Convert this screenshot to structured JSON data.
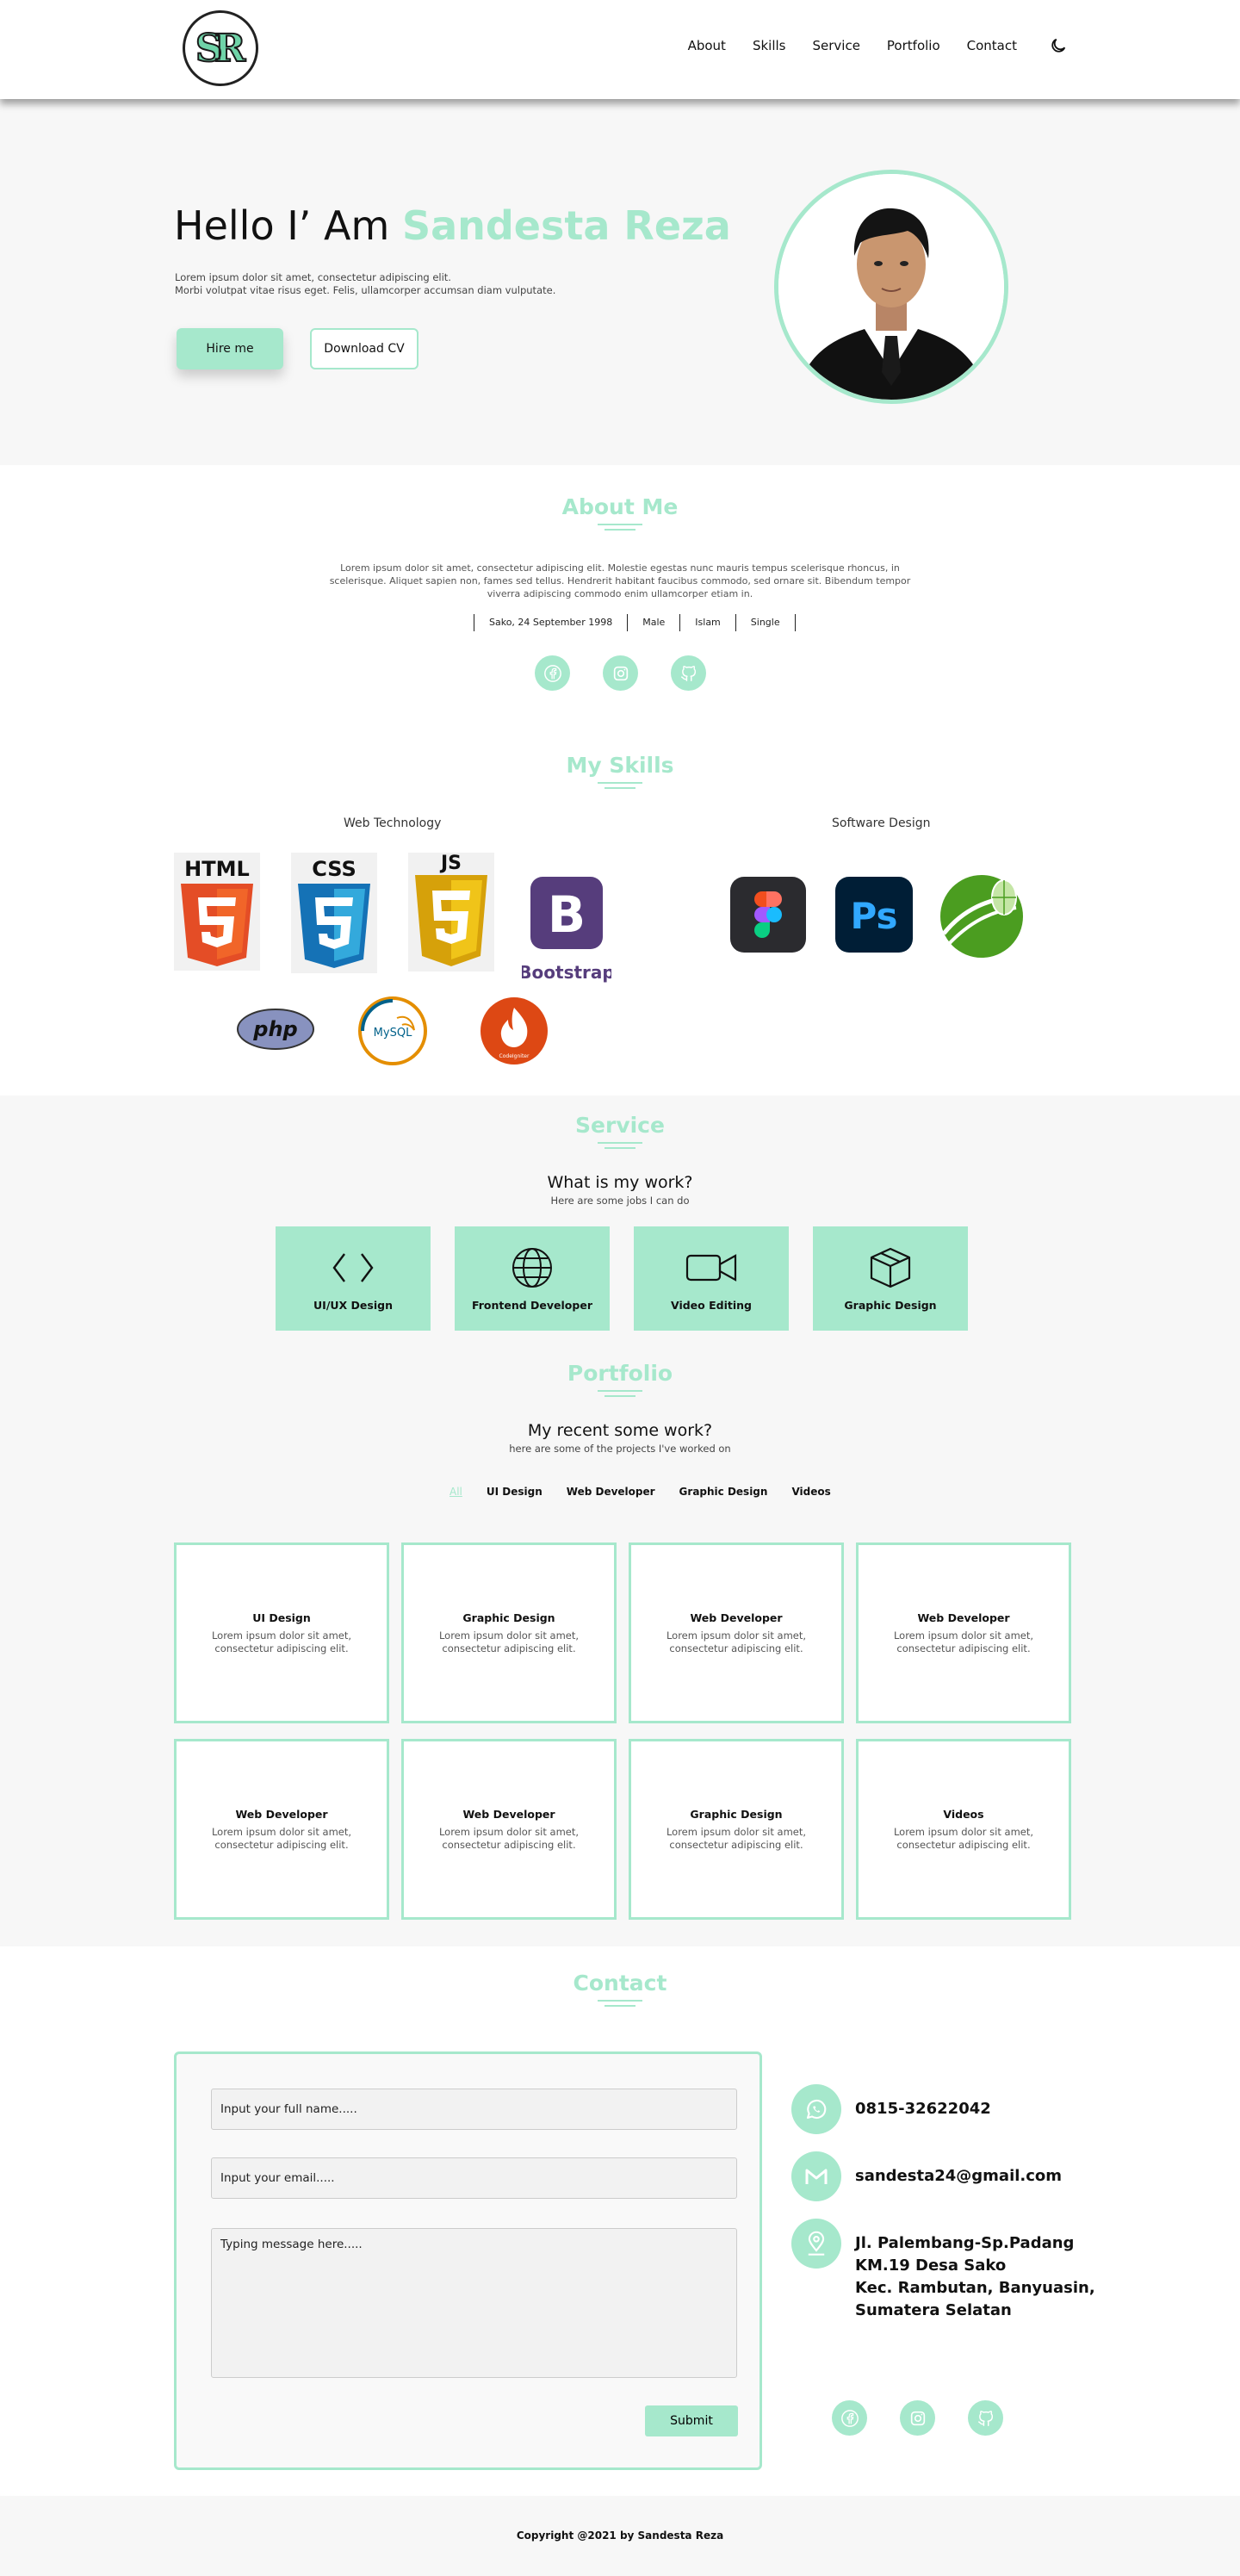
{
  "nav": {
    "logo_text": "SR",
    "links": [
      "About",
      "Skills",
      "Service",
      "Portfolio",
      "Contact"
    ],
    "theme_toggle_icon": "moon-icon"
  },
  "hero": {
    "greeting": "Hello I’ Am",
    "name": "Sandesta Reza",
    "desc_line1": "Lorem ipsum dolor sit amet, consectetur adipiscing elit.",
    "desc_line2": "Morbi volutpat vitae risus eget. Felis, ullamcorper accumsan diam vulputate.",
    "hire_label": "Hire me",
    "cv_label": "Download CV"
  },
  "about": {
    "title": "About Me",
    "text": "Lorem ipsum dolor sit amet, consectetur adipiscing elit. Molestie egestas nunc mauris tempus scelerisque rhoncus, in scelerisque. Aliquet sapien non, fames sed tellus. Hendrerit habitant faucibus commodo, sed ornare sit. Bibendum tempor viverra adipiscing commodo enim ullamcorper etiam in.",
    "facts": [
      "Sako, 24 September 1998",
      "Male",
      "Islam",
      "Single"
    ],
    "socials": [
      "facebook-icon",
      "instagram-icon",
      "github-icon"
    ]
  },
  "skills": {
    "title": "My Skills",
    "web_label": "Web Technology",
    "design_label": "Software Design",
    "web": {
      "html": "HTML",
      "css": "CSS",
      "js": "JS",
      "bootstrap": "Bootstrap",
      "php": "php",
      "mysql": "MySQL",
      "codeigniter": "CodeIgniter"
    },
    "design": {
      "ps": "Ps"
    }
  },
  "service": {
    "title": "Service",
    "heading": "What is my work?",
    "desc": "Here are some jobs I can do",
    "items": [
      {
        "label": "UI/UX Design",
        "icon": "code-icon"
      },
      {
        "label": "Frontend Developer",
        "icon": "globe-icon"
      },
      {
        "label": "Video Editing",
        "icon": "video-camera-icon"
      },
      {
        "label": "Graphic Design",
        "icon": "cube-icon"
      }
    ]
  },
  "portfolio": {
    "title": "Portfolio",
    "heading": "My recent some work?",
    "desc": "here are some of the projects I've worked on",
    "filters": [
      "All",
      "UI Design",
      "Web Developer",
      "Graphic Design",
      "Videos"
    ],
    "active_filter": "All",
    "cards": [
      {
        "title": "UI Design",
        "text": "Lorem ipsum dolor sit amet, consectetur adipiscing elit."
      },
      {
        "title": "Graphic Design",
        "text": "Lorem ipsum dolor sit amet, consectetur adipiscing elit."
      },
      {
        "title": "Web Developer",
        "text": "Lorem ipsum dolor sit amet, consectetur adipiscing elit."
      },
      {
        "title": "Web Developer",
        "text": "Lorem ipsum dolor sit amet, consectetur adipiscing elit."
      },
      {
        "title": "Web Developer",
        "text": "Lorem ipsum dolor sit amet, consectetur adipiscing elit."
      },
      {
        "title": "Web Developer",
        "text": "Lorem ipsum dolor sit amet, consectetur adipiscing elit."
      },
      {
        "title": "Graphic Design",
        "text": "Lorem ipsum dolor sit amet, consectetur adipiscing elit."
      },
      {
        "title": "Videos",
        "text": "Lorem ipsum dolor sit amet, consectetur adipiscing elit."
      }
    ]
  },
  "contact": {
    "title": "Contact",
    "name_placeholder": "Input your full name.....",
    "email_placeholder": "Input your email.....",
    "message_placeholder": "Typing message here.....",
    "submit_label": "Submit",
    "phone": "0815-32622042",
    "email": "sandesta24@gmail.com",
    "address_lines": [
      "Jl. Palembang-Sp.Padang",
      "KM.19 Desa Sako",
      "Kec. Rambutan, Banyuasin,",
      "Sumatera Selatan"
    ]
  },
  "footer": {
    "copyright": "Copyright @2021 by Sandesta Reza"
  },
  "colors": {
    "accent": "#a6e8cc",
    "soft_bg": "#f7f7f7"
  }
}
